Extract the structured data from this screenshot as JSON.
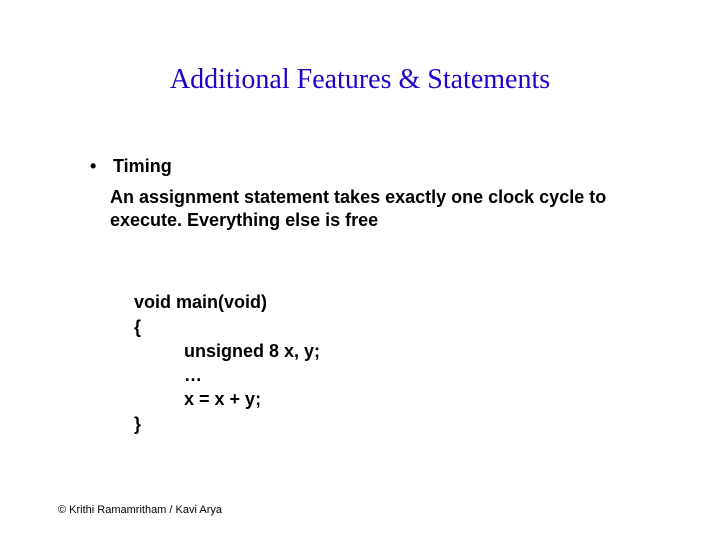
{
  "title": "Additional Features & Statements",
  "bullet": {
    "marker": "•",
    "label": "Timing"
  },
  "description": "An assignment statement takes exactly one clock cycle to execute. Everything else is free",
  "code": {
    "l1": "void main(void)",
    "l2": "{",
    "l3": "          unsigned 8 x, y;",
    "l4": "          …",
    "l5": "          x = x + y;",
    "l6": "}"
  },
  "footer": "© Krithi Ramamritham / Kavi Arya"
}
